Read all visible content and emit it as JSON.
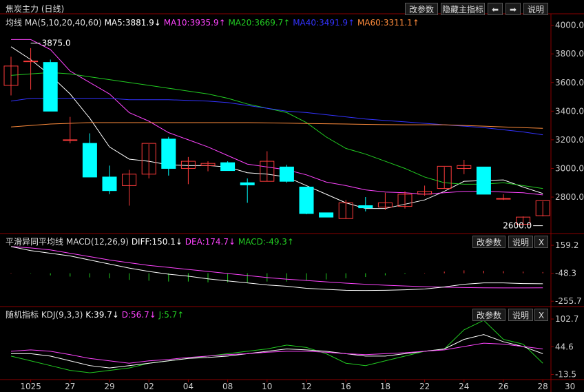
{
  "window_title": "焦炭主力 (日线)",
  "top_buttons": {
    "params": "改参数",
    "hide_main": "隐藏主指标",
    "left_arrow": "⬅",
    "right_arrow": "➡",
    "explain": "说明"
  },
  "panel_buttons": {
    "params": "改参数",
    "explain": "说明",
    "close": "X"
  },
  "colors": {
    "up": "#ff3b3b",
    "down": "#00ffff",
    "ma5": "#ffffff",
    "ma10": "#ff44ff",
    "ma20": "#22cc22",
    "ma40": "#3333ff",
    "ma60": "#ff8c3c",
    "hist_pos": "#ff3b3b",
    "hist_neg": "#22cc22",
    "axis": "#8b0000",
    "grid_text": "#cccccc"
  },
  "main_legend": {
    "name": "均线",
    "spec": "MA(5,10,20,40,60)",
    "ma5": "MA5:3881.9↓",
    "ma10": "MA10:3935.9↑",
    "ma20": "MA20:3669.7↑",
    "ma40": "MA40:3491.9↑",
    "ma60": "MA60:3311.1↑"
  },
  "macd_legend": {
    "name": "平滑异同平均线",
    "spec": "MACD(12,26,9)",
    "diff": "DIFF:150.1↓",
    "dea": "DEA:174.7↓",
    "macd": "MACD:-49.3↑"
  },
  "kdj_legend": {
    "name": "随机指标",
    "spec": "KDJ(9,3,3)",
    "k": "K:39.7↓",
    "d": "D:56.7↓",
    "j": "J:5.7↑"
  },
  "chart_data": [
    {
      "type": "candlestick",
      "title": "焦炭主力 (日线)",
      "y_ticks": [
        "4000.0",
        "3800.0",
        "3600.0",
        "3400.0",
        "3200.0",
        "3000.0",
        "2800.0"
      ],
      "ylim": [
        2550,
        4080
      ],
      "x_ticks": [
        {
          "label": "1025",
          "index": 1
        },
        {
          "label": "27",
          "index": 3
        },
        {
          "label": "29",
          "index": 5
        },
        {
          "label": "02",
          "index": 7
        },
        {
          "label": "04",
          "index": 9
        },
        {
          "label": "08",
          "index": 11
        },
        {
          "label": "10",
          "index": 13
        },
        {
          "label": "12",
          "index": 15
        },
        {
          "label": "16",
          "index": 17
        },
        {
          "label": "18",
          "index": 19
        },
        {
          "label": "22",
          "index": 21
        },
        {
          "label": "24",
          "index": 23
        },
        {
          "label": "26",
          "index": 25
        },
        {
          "label": "28",
          "index": 27
        }
      ],
      "x_tick_last": {
        "label": "30",
        "index": 28.1
      },
      "annotations": [
        {
          "text": "3875.0",
          "index": 1,
          "value": 3875
        },
        {
          "text": "2600.0",
          "index": 27,
          "value": 2600
        }
      ],
      "candles": [
        {
          "o": 3580,
          "h": 3780,
          "c": 3715,
          "l": 3510
        },
        {
          "o": 3745,
          "h": 3840,
          "c": 3750,
          "l": 3550
        },
        {
          "o": 3740,
          "h": 3760,
          "c": 3400,
          "l": 3400
        },
        {
          "o": 3200,
          "h": 3360,
          "c": 3200,
          "l": 3175
        },
        {
          "o": 3175,
          "h": 3245,
          "c": 2940,
          "l": 2940
        },
        {
          "o": 2940,
          "h": 3020,
          "c": 2845,
          "l": 2820
        },
        {
          "o": 2880,
          "h": 2990,
          "c": 2960,
          "l": 2740
        },
        {
          "o": 2960,
          "h": 3170,
          "c": 3175,
          "l": 2930
        },
        {
          "o": 3205,
          "h": 3220,
          "c": 3000,
          "l": 2950
        },
        {
          "o": 3000,
          "h": 3080,
          "c": 3050,
          "l": 2890
        },
        {
          "o": 3020,
          "h": 3050,
          "c": 3035,
          "l": 2980
        },
        {
          "o": 3040,
          "h": 3050,
          "c": 2985,
          "l": 2985
        },
        {
          "o": 2900,
          "h": 2930,
          "c": 2885,
          "l": 2760
        },
        {
          "o": 2910,
          "h": 3120,
          "c": 3050,
          "l": 2910
        },
        {
          "o": 3010,
          "h": 3025,
          "c": 2910,
          "l": 2900
        },
        {
          "o": 2870,
          "h": 2870,
          "c": 2685,
          "l": 2680
        },
        {
          "o": 2690,
          "h": 2690,
          "c": 2660,
          "l": 2660
        },
        {
          "o": 2650,
          "h": 2780,
          "c": 2760,
          "l": 2650
        },
        {
          "o": 2740,
          "h": 2800,
          "c": 2725,
          "l": 2700
        },
        {
          "o": 2730,
          "h": 2830,
          "c": 2760,
          "l": 2710
        },
        {
          "o": 2735,
          "h": 2840,
          "c": 2820,
          "l": 2720
        },
        {
          "o": 2820,
          "h": 2880,
          "c": 2840,
          "l": 2810
        },
        {
          "o": 2860,
          "h": 3010,
          "c": 3015,
          "l": 2860
        },
        {
          "o": 3000,
          "h": 3060,
          "c": 3020,
          "l": 2960
        },
        {
          "o": 3010,
          "h": 3010,
          "c": 2820,
          "l": 2820
        },
        {
          "o": 2790,
          "h": 2820,
          "c": 2790,
          "l": 2780
        },
        {
          "o": 2610,
          "h": 2665,
          "c": 2660,
          "l": 2600
        },
        {
          "o": 2670,
          "h": 2770,
          "c": 2775,
          "l": 2665
        }
      ],
      "ma_series": [
        {
          "key": "ma5",
          "values": [
            3850,
            3760,
            3650,
            3520,
            3350,
            3150,
            3065,
            3050,
            3025,
            3020,
            3020,
            3010,
            2970,
            2960,
            2940,
            2880,
            2820,
            2760,
            2720,
            2720,
            2750,
            2780,
            2840,
            2910,
            2915,
            2920,
            2870,
            2825
          ]
        },
        {
          "key": "ma10",
          "values": [
            3900,
            3900,
            3830,
            3680,
            3600,
            3520,
            3390,
            3330,
            3250,
            3200,
            3150,
            3090,
            3030,
            3010,
            2990,
            2955,
            2905,
            2880,
            2850,
            2835,
            2830,
            2820,
            2830,
            2840,
            2840,
            2835,
            2830,
            2815
          ]
        },
        {
          "key": "ma20",
          "values": [
            3650,
            3660,
            3670,
            3660,
            3640,
            3620,
            3600,
            3580,
            3560,
            3540,
            3520,
            3490,
            3450,
            3420,
            3390,
            3320,
            3220,
            3140,
            3100,
            3050,
            3000,
            2940,
            2900,
            2890,
            2890,
            2900,
            2880,
            2860
          ]
        },
        {
          "key": "ma40",
          "values": [
            3470,
            3490,
            3490,
            3490,
            3490,
            3490,
            3480,
            3480,
            3480,
            3475,
            3470,
            3460,
            3440,
            3420,
            3400,
            3390,
            3375,
            3360,
            3345,
            3335,
            3325,
            3315,
            3305,
            3295,
            3285,
            3270,
            3255,
            3235
          ]
        },
        {
          "key": "ma60",
          "values": [
            3290,
            3300,
            3310,
            3315,
            3320,
            3320,
            3320,
            3320,
            3320,
            3320,
            3320,
            3320,
            3320,
            3318,
            3316,
            3314,
            3312,
            3310,
            3308,
            3306,
            3305,
            3305,
            3305,
            3300,
            3295,
            3290,
            3285,
            3280
          ]
        }
      ]
    },
    {
      "type": "line",
      "title": "MACD(12,26,9)",
      "y_ticks": [
        "159.2",
        "-48.3",
        "-255.7"
      ],
      "ylim": [
        -270,
        180
      ],
      "series": [
        {
          "key": "dea",
          "values": [
            150,
            140,
            125,
            100,
            75,
            50,
            30,
            10,
            -5,
            -20,
            -35,
            -50,
            -65,
            -80,
            -92,
            -102,
            -112,
            -122,
            -130,
            -137,
            -143,
            -148,
            -152,
            -154,
            -156,
            -157,
            -157,
            -156
          ]
        },
        {
          "key": "diff",
          "values": [
            150,
            120,
            100,
            80,
            50,
            20,
            -10,
            -35,
            -55,
            -70,
            -90,
            -105,
            -120,
            -135,
            -145,
            -160,
            -168,
            -175,
            -176,
            -175,
            -171,
            -165,
            -150,
            -130,
            -120,
            -120,
            -125,
            -126
          ]
        }
      ],
      "histogram": [
        5,
        -5,
        -25,
        -40,
        -50,
        -60,
        -80,
        -90,
        -100,
        -100,
        -110,
        -110,
        -110,
        -100,
        -100,
        -90,
        -75,
        -60,
        -45,
        -25,
        -10,
        5,
        20,
        35,
        30,
        25,
        20,
        15
      ]
    },
    {
      "type": "line",
      "title": "KDJ(9,3,3)",
      "y_ticks": [
        "102.7",
        "44.6",
        "-13.5"
      ],
      "ylim": [
        -20,
        110
      ],
      "series": [
        {
          "key": "j",
          "values": [
            25,
            15,
            5,
            -5,
            -10,
            -5,
            0,
            10,
            15,
            20,
            25,
            30,
            35,
            40,
            48,
            43,
            30,
            10,
            5,
            15,
            25,
            35,
            40,
            80,
            100,
            60,
            50,
            10
          ]
        },
        {
          "key": "k",
          "values": [
            30,
            30,
            25,
            15,
            5,
            0,
            5,
            10,
            15,
            20,
            22,
            25,
            30,
            35,
            40,
            38,
            35,
            30,
            25,
            25,
            30,
            35,
            40,
            60,
            70,
            55,
            45,
            30
          ]
        },
        {
          "key": "d",
          "values": [
            35,
            38,
            35,
            28,
            20,
            15,
            10,
            15,
            18,
            22,
            25,
            28,
            30,
            33,
            35,
            35,
            33,
            30,
            28,
            30,
            32,
            35,
            38,
            45,
            52,
            50,
            45,
            40
          ]
        }
      ]
    }
  ]
}
